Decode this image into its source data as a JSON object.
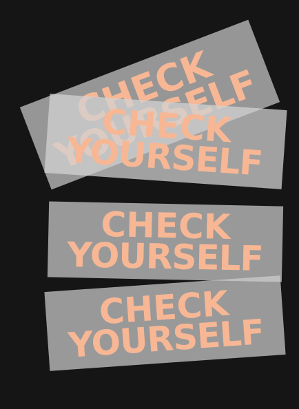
{
  "stickers": [
    {
      "line1": "CHECK",
      "line2": "YOURSELF"
    },
    {
      "line1": "CHECK",
      "line2": "YOURSELF"
    },
    {
      "line1": "CHECK",
      "line2": "YOURSELF"
    },
    {
      "line1": "CHECK",
      "line2": "YOURSELF"
    }
  ],
  "colors": {
    "background": "#151515",
    "sticker": "#cdcdcd",
    "text": "#f7b795"
  }
}
